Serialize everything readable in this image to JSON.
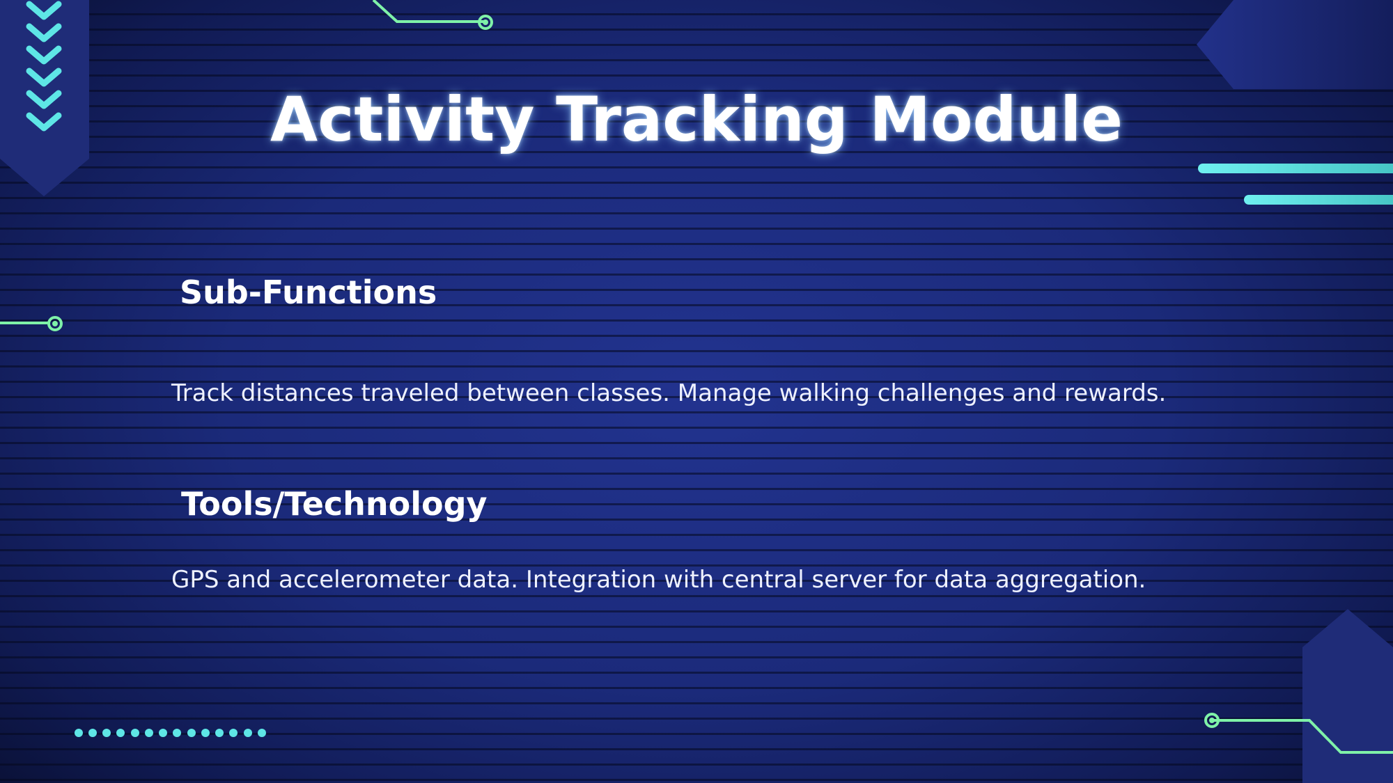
{
  "slide": {
    "title": "Activity Tracking Module",
    "sections": [
      {
        "heading": "Sub-Functions",
        "body": "Track distances traveled between classes. Manage walking challenges and rewards."
      },
      {
        "heading": "Tools/Technology",
        "body": "GPS and accelerometer data. Integration with central server for data aggregation."
      }
    ]
  },
  "colors": {
    "background": "#1b2a7a",
    "accent_cyan": "#5ee6e6",
    "accent_green": "#7ff2a8",
    "panel": "#1f2c78",
    "text": "#ffffff"
  },
  "decorations": [
    "chevron-down-icon",
    "circuit-node-icon",
    "dot-row",
    "cyan-stripes",
    "hexagon-panels"
  ]
}
